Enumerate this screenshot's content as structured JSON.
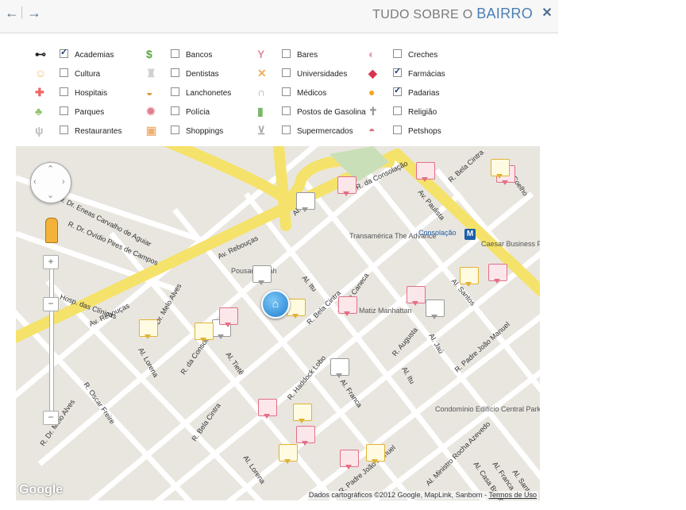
{
  "header": {
    "title_prefix": "TUDO SOBRE O",
    "title_accent": "BAIRRO",
    "back_icon": "arrow-left-icon",
    "forward_icon": "arrow-right-icon",
    "close_icon": "close-icon"
  },
  "categories": [
    {
      "label": "Academias",
      "icon": "dumbbell-icon",
      "checked": true
    },
    {
      "label": "Bancos",
      "icon": "dollar-icon",
      "checked": false
    },
    {
      "label": "Bares",
      "icon": "cocktail-icon",
      "checked": false
    },
    {
      "label": "Creches",
      "icon": "baby-bottle-icon",
      "checked": false
    },
    {
      "label": "Cultura",
      "icon": "theater-icon",
      "checked": false
    },
    {
      "label": "Dentistas",
      "icon": "tooth-icon",
      "checked": false
    },
    {
      "label": "Universidades",
      "icon": "pencil-ruler-icon",
      "checked": false
    },
    {
      "label": "Farmácias",
      "icon": "pill-icon",
      "checked": true
    },
    {
      "label": "Hospitais",
      "icon": "hospital-cross-icon",
      "checked": false
    },
    {
      "label": "Lanchonetes",
      "icon": "burger-icon",
      "checked": false
    },
    {
      "label": "Médicos",
      "icon": "stethoscope-icon",
      "checked": false
    },
    {
      "label": "Padarias",
      "icon": "bread-icon",
      "checked": true
    },
    {
      "label": "Parques",
      "icon": "tree-icon",
      "checked": false
    },
    {
      "label": "Polícia",
      "icon": "police-badge-icon",
      "checked": false
    },
    {
      "label": "Postos de Gasolina",
      "icon": "gas-pump-icon",
      "checked": false
    },
    {
      "label": "Religião",
      "icon": "church-icon",
      "checked": false
    },
    {
      "label": "Restaurantes",
      "icon": "cutlery-icon",
      "checked": false
    },
    {
      "label": "Shoppings",
      "icon": "shopping-bag-icon",
      "checked": false
    },
    {
      "label": "Supermercados",
      "icon": "cart-icon",
      "checked": false
    },
    {
      "label": "Petshops",
      "icon": "pet-bowl-icon",
      "checked": false
    }
  ],
  "map": {
    "streets": [
      "Av. Dr. Eneas Carvalho de Aguiar",
      "Al. Jaú",
      "R. da Consolação",
      "R. Bela Cintra",
      "Coelho",
      "Av. Paulista",
      "R. Dr. Ovídio Pires de Campos",
      "Av. Rebouças",
      "Av. Rebouças",
      "Hosp. das Clínicas",
      "Dr. Melo Alves",
      "Al. Itu",
      "R. Bela Cintra",
      "R. Frei Caneca",
      "Al. Santos",
      "Al. Lorena",
      "R. da Consolação",
      "Al. Tietê",
      "R. Augusta",
      "Al. Jaú",
      "R. Padre João Manuel",
      "R. Haddock Lobo",
      "Al. Franca",
      "Al. Itu",
      "R. Oscar Freire",
      "R. Dr. Melo Alves",
      "R. Bela Cintra",
      "Al. Lorena",
      "R. Padre João Manuel",
      "Al. Ministro Rocha Azevedo",
      "Al. Casa Branca",
      "Al. Franca",
      "Al. Santos"
    ],
    "pois": [
      "Transamérica The Advance",
      "Matiz Manhattan",
      "Pousada Zilah",
      "Caesar Business Paulista",
      "Condomínio Edifício Central Park Residence Service"
    ],
    "metro_label": "Consolação",
    "metro_symbol": "M",
    "home_symbol": "⌂",
    "zoom_in": "+",
    "zoom_out": "−",
    "google_logo": "Google",
    "attribution_text": "Dados cartográficos ©2012 Google, MapLink, Sanborn -",
    "attribution_link": "Termos de Uso"
  }
}
